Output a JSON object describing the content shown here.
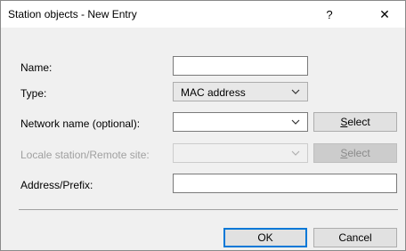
{
  "window": {
    "title": "Station objects - New Entry",
    "help_glyph": "?",
    "close_glyph": "✕"
  },
  "form": {
    "name": {
      "label": "Name:",
      "value": ""
    },
    "type": {
      "label": "Type:",
      "selected": "MAC address"
    },
    "network_name": {
      "label": "Network name (optional):",
      "value": "",
      "select_label_underlined": "S",
      "select_label_rest": "elect"
    },
    "locale_station": {
      "label": "Locale station/Remote site:",
      "value": "",
      "disabled": true,
      "select_label_underlined": "S",
      "select_label_rest": "elect"
    },
    "address_prefix": {
      "label": "Address/Prefix:",
      "value": ""
    }
  },
  "buttons": {
    "ok": "OK",
    "cancel": "Cancel"
  },
  "colors": {
    "accent": "#0078d7",
    "dialog_bg": "#f0f0f0",
    "disabled_text": "#a0a0a0"
  }
}
